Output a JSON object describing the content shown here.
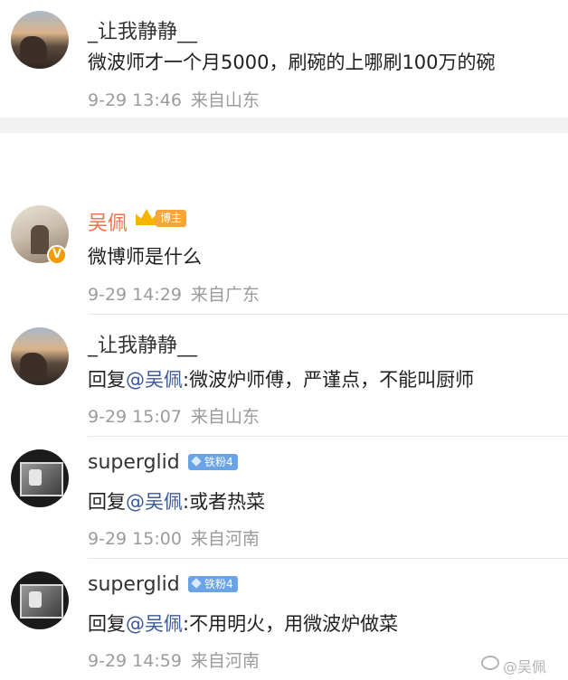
{
  "comments": [
    {
      "user": "_让我静静__",
      "text": "微波师才一个月5000，刷碗的上哪刷100万的碗",
      "date": "9-29 13:46",
      "location": "来自山东"
    },
    {
      "user": "吴佩",
      "badge": "博主",
      "text": "微博师是什么",
      "date": "9-29 14:29",
      "location": "来自广东"
    },
    {
      "user": "_让我静静__",
      "reply_prefix": "回复",
      "mention": "@吴佩",
      "text": ":微波炉师傅，严谨点，不能叫厨师",
      "date": "9-29 15:07",
      "location": "来自山东"
    },
    {
      "user": "superglid",
      "badge": "铁粉4",
      "reply_prefix": "回复",
      "mention": "@吴佩",
      "text": ":或者热菜",
      "date": "9-29 15:00",
      "location": "来自河南"
    },
    {
      "user": "superglid",
      "badge": "铁粉4",
      "reply_prefix": "回复",
      "mention": "@吴佩",
      "text": ":不用明火，用微波炉做菜",
      "date": "9-29 14:59",
      "location": "来自河南"
    }
  ],
  "watermark": "@吴佩",
  "colors": {
    "mention": "#3b5998",
    "blogger_name": "#eb7350",
    "meta": "#9b9b9b"
  }
}
